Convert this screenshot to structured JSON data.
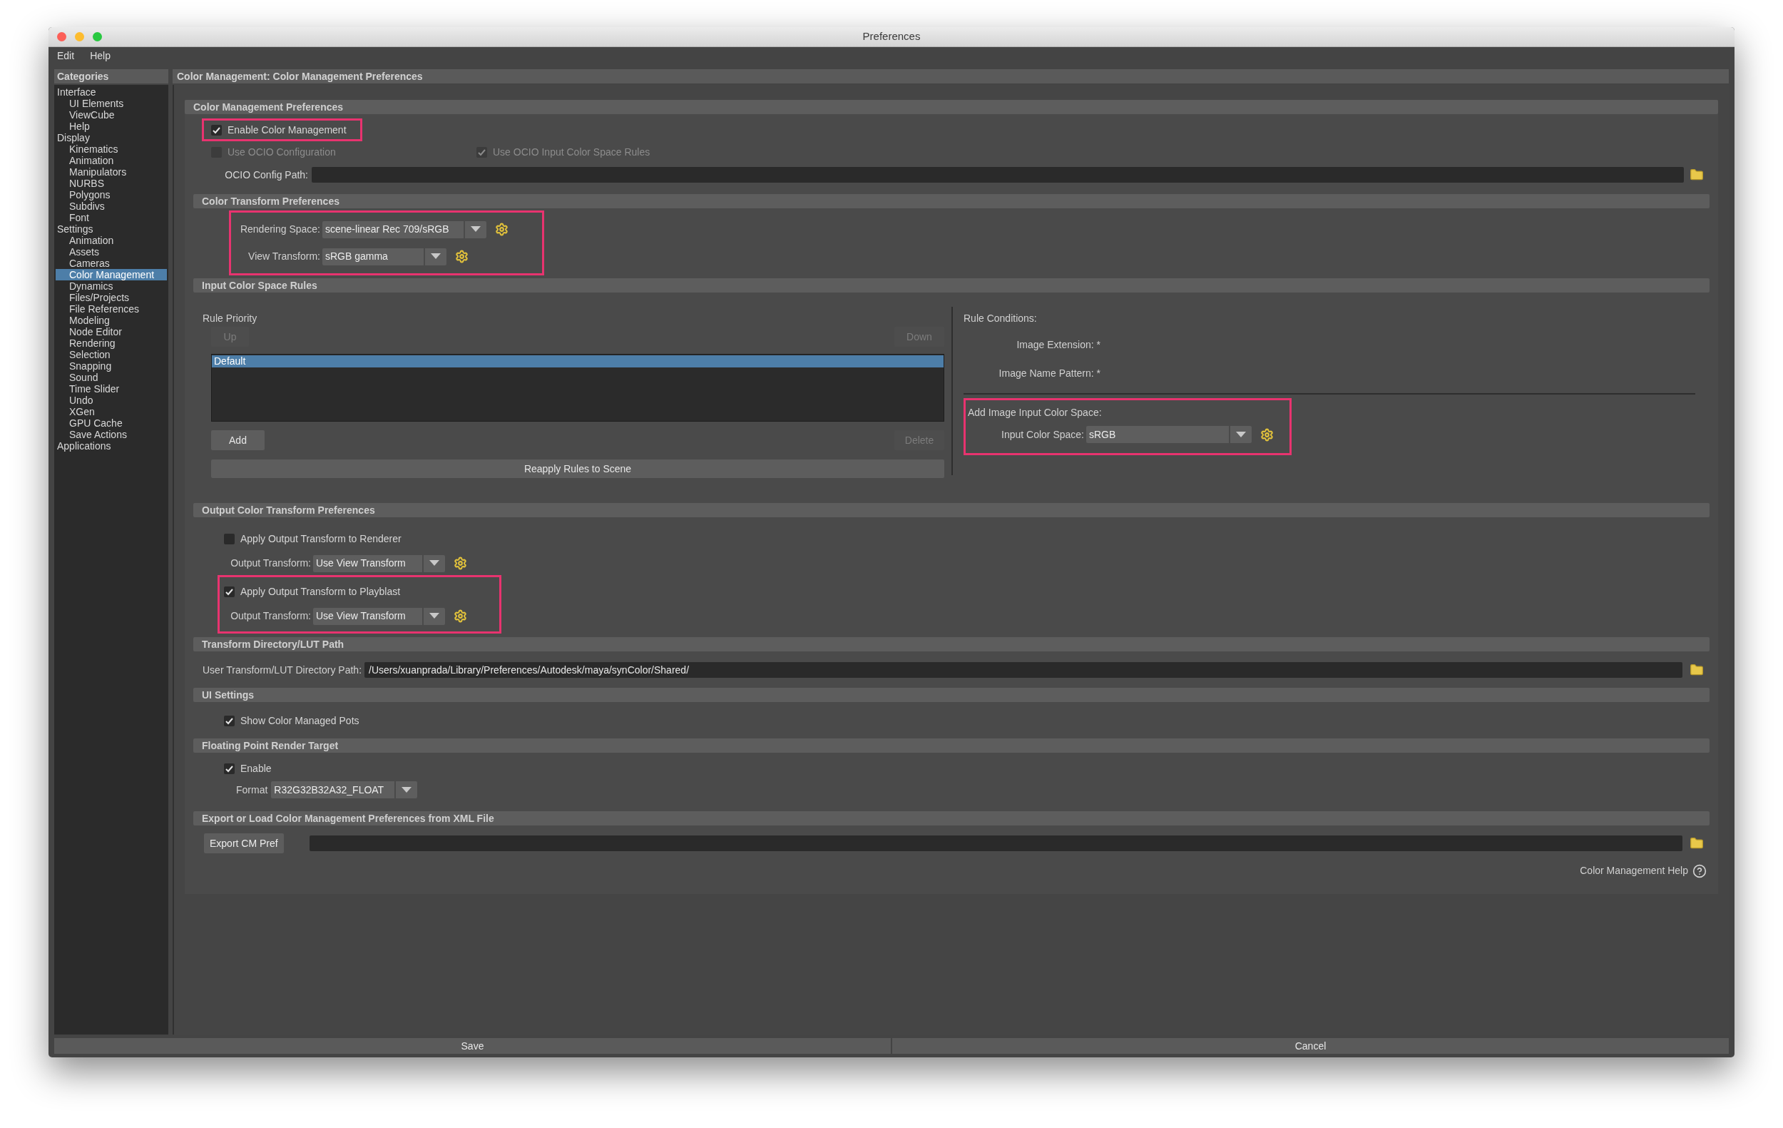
{
  "window": {
    "title": "Preferences"
  },
  "menu": [
    "Edit",
    "Help"
  ],
  "categories": {
    "title": "Categories",
    "items": [
      {
        "label": "Interface",
        "selected": false,
        "children": [
          {
            "label": "UI Elements",
            "selected": false
          },
          {
            "label": "ViewCube",
            "selected": false
          },
          {
            "label": "Help",
            "selected": false
          }
        ]
      },
      {
        "label": "Display",
        "selected": false,
        "children": [
          {
            "label": "Kinematics",
            "selected": false
          },
          {
            "label": "Animation",
            "selected": false
          },
          {
            "label": "Manipulators",
            "selected": false
          },
          {
            "label": "NURBS",
            "selected": false
          },
          {
            "label": "Polygons",
            "selected": false
          },
          {
            "label": "Subdivs",
            "selected": false
          },
          {
            "label": "Font",
            "selected": false
          }
        ]
      },
      {
        "label": "Settings",
        "selected": false,
        "children": [
          {
            "label": "Animation",
            "selected": false
          },
          {
            "label": "Assets",
            "selected": false
          },
          {
            "label": "Cameras",
            "selected": false
          },
          {
            "label": "Color Management",
            "selected": true
          },
          {
            "label": "Dynamics",
            "selected": false
          },
          {
            "label": "Files/Projects",
            "selected": false
          },
          {
            "label": "File References",
            "selected": false
          },
          {
            "label": "Modeling",
            "selected": false
          },
          {
            "label": "Node Editor",
            "selected": false
          },
          {
            "label": "Rendering",
            "selected": false
          },
          {
            "label": "Selection",
            "selected": false
          },
          {
            "label": "Snapping",
            "selected": false
          },
          {
            "label": "Sound",
            "selected": false
          },
          {
            "label": "Time Slider",
            "selected": false
          },
          {
            "label": "Undo",
            "selected": false
          },
          {
            "label": "XGen",
            "selected": false
          },
          {
            "label": "GPU Cache",
            "selected": false
          },
          {
            "label": "Save Actions",
            "selected": false
          }
        ]
      },
      {
        "label": "Applications",
        "selected": false
      }
    ]
  },
  "panel_title": "Color Management: Color Management Preferences",
  "cm_prefs": {
    "title": "Color Management Preferences",
    "enable": {
      "label": "Enable Color Management",
      "checked": true,
      "disabled": false,
      "highlighted": true
    },
    "use_ocio": {
      "label": "Use OCIO Configuration",
      "checked": false,
      "disabled": true
    },
    "use_ocio_rules": {
      "label": "Use OCIO Input Color Space Rules",
      "checked": true,
      "disabled": true
    },
    "config_path": {
      "label": "OCIO Config Path:"
    }
  },
  "transform_prefs": {
    "title": "Color Transform Preferences",
    "highlighted": true,
    "rows": [
      {
        "label": "Rendering Space:",
        "value": "scene-linear Rec 709/sRGB"
      },
      {
        "label": "View Transform:",
        "value": "sRGB gamma"
      }
    ]
  },
  "input_rules": {
    "title": "Input Color Space Rules",
    "priority_label": "Rule Priority",
    "up": {
      "label": "Up",
      "disabled": true
    },
    "down": {
      "label": "Down",
      "disabled": true
    },
    "rules": [
      {
        "label": "Default",
        "selected": true
      }
    ],
    "add": {
      "label": "Add",
      "disabled": false
    },
    "delete": {
      "label": "Delete",
      "disabled": true
    },
    "reapply": "Reapply Rules to Scene",
    "conditions_label": "Rule Conditions:",
    "conditions": [
      "Image Extension: *",
      "Image Name Pattern: *"
    ],
    "add_space": {
      "label": "Add Image Input Color Space:",
      "highlighted": true,
      "field_label": "Input Color Space:",
      "value": "sRGB"
    }
  },
  "output_prefs": {
    "title": "Output Color Transform Preferences",
    "groups": [
      {
        "label": "Apply Output Transform to Renderer",
        "checked": false,
        "field_label": "Output Transform:",
        "value": "Use View Transform",
        "highlighted": false
      },
      {
        "label": "Apply Output Transform to Playblast",
        "checked": true,
        "field_label": "Output Transform:",
        "value": "Use View Transform",
        "highlighted": true
      }
    ]
  },
  "lut_path": {
    "title": "Transform Directory/LUT Path",
    "label": "User Transform/LUT Directory Path:",
    "value": "/Users/xuanprada/Library/Preferences/Autodesk/maya/synColor/Shared/"
  },
  "ui_settings": {
    "title": "UI Settings",
    "show_pots": {
      "label": "Show Color Managed Pots",
      "checked": true
    }
  },
  "float_target": {
    "title": "Floating Point Render Target",
    "enable": {
      "label": "Enable",
      "checked": true
    },
    "format_label": "Format",
    "format": "R32G32B32A32_FLOAT"
  },
  "export": {
    "title": "Export or Load Color Management Preferences from XML File",
    "button": "Export CM Pref"
  },
  "help_link": "Color Management Help",
  "buttons": [
    "Save",
    "Cancel"
  ]
}
